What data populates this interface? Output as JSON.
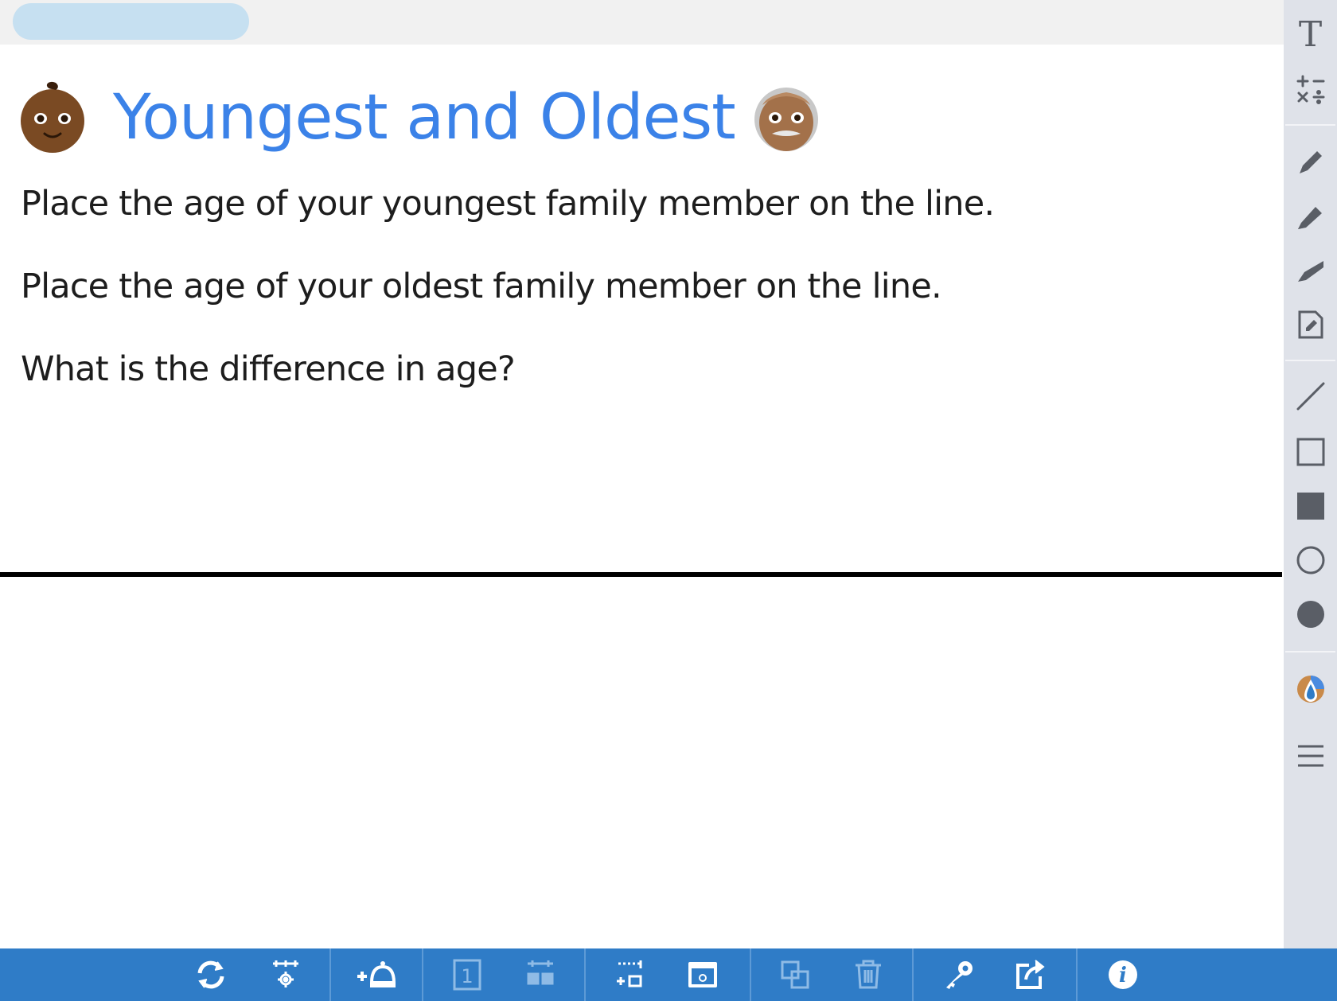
{
  "header": {
    "title": "Youngest and Oldest"
  },
  "prompts": [
    "Place the age of your youngest family member on the line.",
    "Place the age of your oldest family member on the line.",
    "What is the difference in age?"
  ],
  "colors": {
    "title": "#3b82e8",
    "body_text": "#1d1d1d",
    "rail_bg": "#dfe2e9",
    "rail_icon": "#5a5e66",
    "toolbar_bg": "#2f7cc7",
    "toolbar_icon": "#ffffff",
    "toolbar_icon_disabled": "#8fbbe6",
    "pill": "#c6e0f1"
  },
  "emojis": {
    "left": "baby-face-emoji",
    "right": "old-man-emoji"
  },
  "tools": {
    "text": {
      "icon": "text-icon",
      "label": "T"
    },
    "math": "math-symbols-icon",
    "pen": "pen-icon",
    "marker": "marker-icon",
    "highlighter": "highlighter-icon",
    "note": "note-icon",
    "line": "line-icon",
    "rectangle_outline": "rectangle-outline-icon",
    "rectangle_filled": "rectangle-filled-icon",
    "circle_outline": "circle-outline-icon",
    "circle_filled": "circle-filled-icon",
    "color_picker": "color-picker-icon",
    "line_weight": "line-weight-icon"
  },
  "toolbar": [
    "refresh-icon",
    "grid-settings-icon",
    "add-bell-icon",
    "page-number-icon",
    "grid-layout-icon",
    "add-frame-icon",
    "camera-icon",
    "duplicate-icon",
    "trash-icon",
    "key-icon",
    "share-icon",
    "info-icon"
  ],
  "toolbar_labels": {
    "page_number": "1",
    "info": "i"
  }
}
